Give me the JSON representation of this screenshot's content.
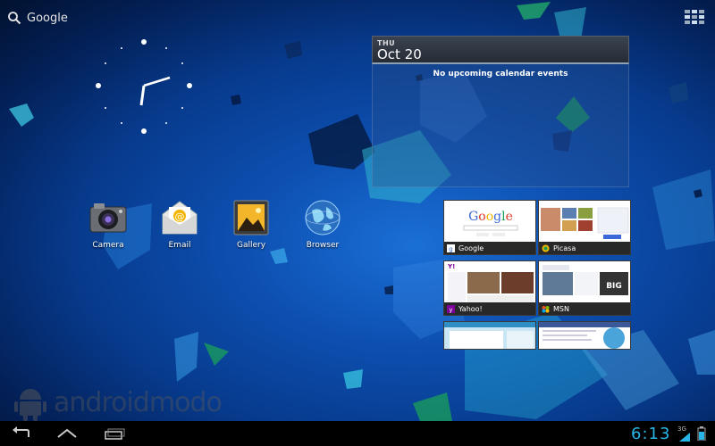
{
  "search": {
    "label": "Google"
  },
  "calendar": {
    "day_of_week": "THU",
    "date": "Oct 20",
    "empty_message": "No upcoming calendar events"
  },
  "shortcuts": [
    {
      "label": "Camera"
    },
    {
      "label": "Email"
    },
    {
      "label": "Gallery"
    },
    {
      "label": "Browser"
    }
  ],
  "bookmarks": [
    {
      "title": "Google"
    },
    {
      "title": "Picasa"
    },
    {
      "title": "Yahoo!"
    },
    {
      "title": "MSN"
    },
    {
      "title": ""
    },
    {
      "title": ""
    }
  ],
  "watermark": {
    "text": "androidmodo"
  },
  "status_bar": {
    "time": "6:13",
    "network": "3G"
  },
  "colors": {
    "clock_accent": "#28b5e6",
    "wallpaper_blue": "#0d4fb0"
  }
}
